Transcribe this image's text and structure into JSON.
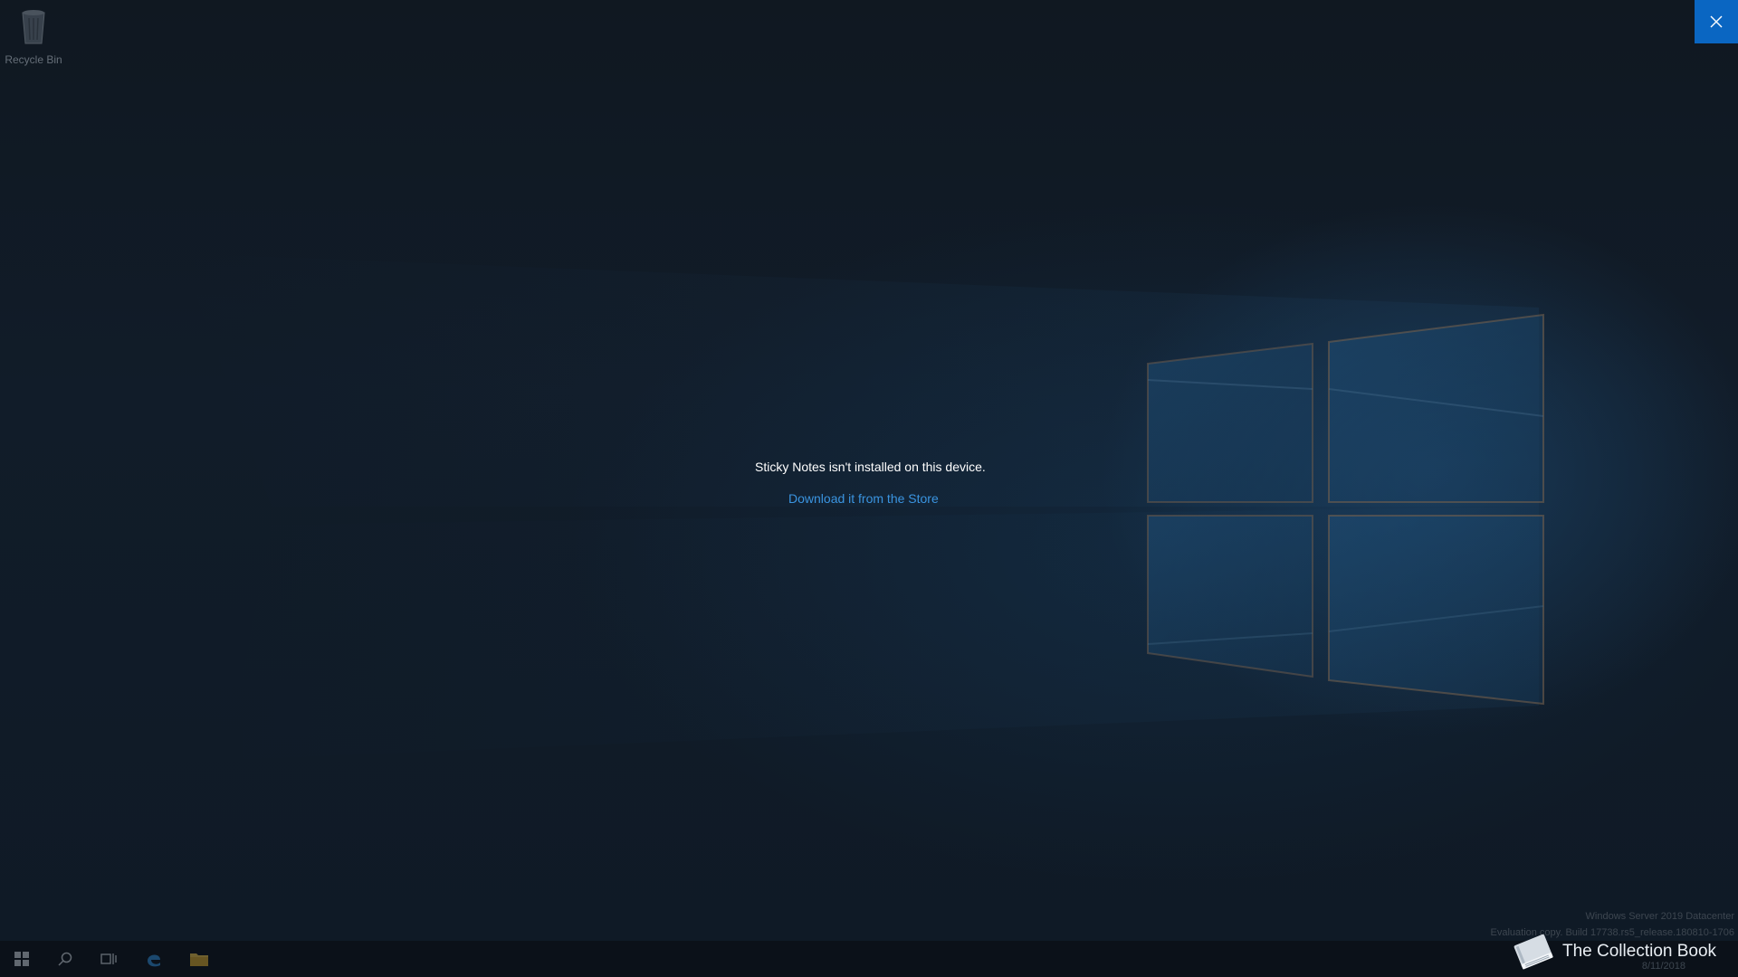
{
  "desktop": {
    "icons": [
      {
        "label": "Recycle Bin",
        "icon": "recycle-bin-icon"
      }
    ]
  },
  "dialog": {
    "message": "Sticky Notes isn't installed on this device.",
    "link_text": "Download it from the Store",
    "close_icon": "close-icon"
  },
  "watermark": {
    "line1": "Windows Server 2019 Datacenter",
    "line2": "Evaluation copy. Build 17738.rs5_release.180810-1706"
  },
  "taskbar": {
    "buttons": [
      "start-icon",
      "search-icon",
      "task-view-icon",
      "edge-icon",
      "file-explorer-icon"
    ],
    "date": "8/11/2018"
  },
  "brand": {
    "text": "The Collection Book",
    "icon": "book-icon"
  },
  "colors": {
    "accent": "#0a66c2",
    "link": "#3a94e0",
    "message_text": "#ffffff",
    "background": "#101a26"
  }
}
